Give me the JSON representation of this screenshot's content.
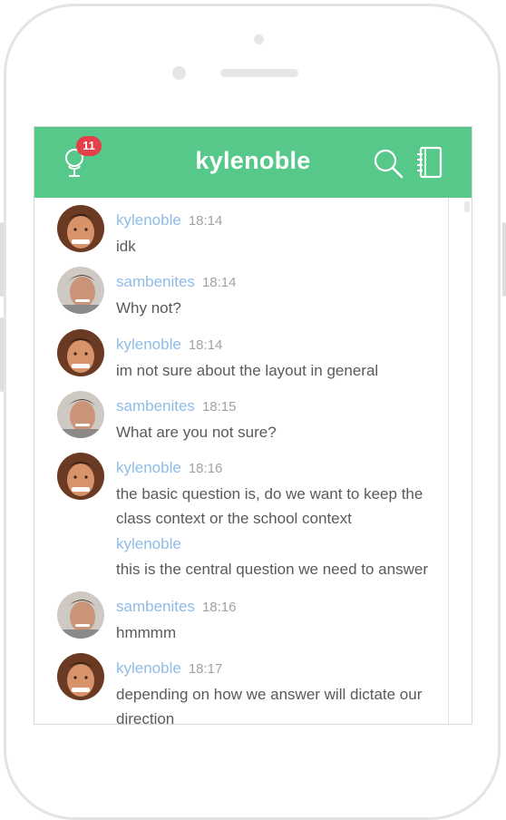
{
  "header": {
    "title": "kylenoble",
    "notification_count": "11",
    "accent_color": "#55c88a",
    "badge_color": "#e5404a",
    "icons": [
      "microphone-icon",
      "search-icon",
      "contacts-book-icon"
    ]
  },
  "messages": [
    {
      "author": "kylenoble",
      "time": "18:14",
      "lines": [
        "idk"
      ],
      "avatar": "kylenoble"
    },
    {
      "author": "sambenites",
      "time": "18:14",
      "lines": [
        "Why not?"
      ],
      "avatar": "sambenites"
    },
    {
      "author": "kylenoble",
      "time": "18:14",
      "lines": [
        "im not sure about the layout in general"
      ],
      "avatar": "kylenoble"
    },
    {
      "author": "sambenites",
      "time": "18:15",
      "lines": [
        "What are you not sure?"
      ],
      "avatar": "sambenites"
    },
    {
      "author": "kylenoble",
      "time": "18:16",
      "lines": [
        "the basic question is, do we want to keep the",
        "class context or the school context"
      ],
      "avatar": "kylenoble"
    },
    {
      "author": "kylenoble",
      "time": "",
      "lines": [
        "this is the central question we need to answer"
      ],
      "avatar": ""
    },
    {
      "author": "sambenites",
      "time": "18:16",
      "lines": [
        "hmmmm"
      ],
      "avatar": "sambenites"
    },
    {
      "author": "kylenoble",
      "time": "18:17",
      "lines": [
        "depending on how we answer will dictate our",
        "direction"
      ],
      "avatar": "kylenoble"
    }
  ]
}
